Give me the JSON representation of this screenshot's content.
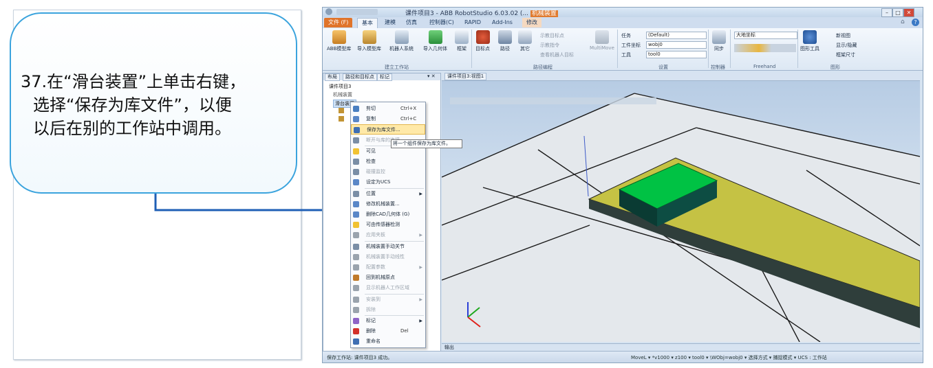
{
  "instruction": {
    "number": "37.",
    "line1": "在“滑台装置”上单击右键，",
    "line2": "选择“保存为库文件”，以便",
    "line3": "以后在别的工作站中调用。"
  },
  "window": {
    "title": "课件项目3 - ABB RobotStudio 6.03.02 (...",
    "title_highlight": "机械装置"
  },
  "tabs": [
    "文件 (F)",
    "基本",
    "建模",
    "仿真",
    "控制器(C)",
    "RAPID",
    "Add-Ins",
    "修改"
  ],
  "ribbon": {
    "buttons": [
      "ABB模型库",
      "导入模型库",
      "机器人系统",
      "导入几何体",
      "框架",
      "目标点",
      "路径",
      "其它"
    ],
    "path_items": [
      "示教目标点",
      "示教指令",
      "查看机器人目标"
    ],
    "multimove": "MultiMove",
    "settings_labels": [
      "任务",
      "工件坐标",
      "工具"
    ],
    "settings_values": [
      "(Default)",
      "wobj0",
      "tool0"
    ],
    "freehand_select": "大地坐标",
    "sync": "同步",
    "graphics_tools": "图形工具",
    "view_items": [
      "新视图",
      "显示/隐藏",
      "框架尺寸"
    ],
    "groups": [
      "建立工作站",
      "路径编程",
      "设置",
      "控制器",
      "Freehand",
      "图形"
    ]
  },
  "tree": {
    "tabs": [
      "布局",
      "路径和目标点",
      "标记"
    ],
    "root": "课件项目3",
    "mechanisms": "机械装置",
    "selected": "滑台装置"
  },
  "context_menu": [
    {
      "label": "剪切",
      "shortcut": "Ctrl+X"
    },
    {
      "label": "复制",
      "shortcut": "Ctrl+C"
    },
    {
      "label": "保存为库文件...",
      "highlight": true
    },
    {
      "label": "断开与库的连接",
      "disabled": true
    },
    {
      "label": "可见",
      "checked": true
    },
    {
      "label": "检查"
    },
    {
      "label": "碰撞监控",
      "disabled": true
    },
    {
      "label": "设定为UCS"
    },
    {
      "label": "位置",
      "submenu": true
    },
    {
      "label": "修改机械装置..."
    },
    {
      "label": "删除CAD几何体 (G)"
    },
    {
      "label": "可由传感器检测",
      "checked": true
    },
    {
      "label": "应用夹板",
      "disabled": true,
      "submenu": true
    },
    {
      "label": "机械装置手动关节"
    },
    {
      "label": "机械装置手动线性",
      "disabled": true
    },
    {
      "label": "配置参数",
      "disabled": true,
      "submenu": true
    },
    {
      "label": "回到机械原点"
    },
    {
      "label": "显示机器人工作区域",
      "disabled": true
    },
    {
      "label": "安装到",
      "disabled": true,
      "submenu": true
    },
    {
      "label": "拆除",
      "disabled": true
    },
    {
      "label": "标记",
      "submenu": true
    },
    {
      "label": "删除",
      "shortcut": "Del"
    },
    {
      "label": "重命名"
    }
  ],
  "tooltip": "将一个组件保存为库文件。",
  "viewport_tab": "课件项目3:视图1",
  "output_tab": "输出",
  "status": {
    "left": "保存工作站: 课件项目3 成功。",
    "right": "MoveL ▾ *v1000 ▾ z100 ▾ tool0 ▾ \\WObj=wobj0 ▾   选择方式 ▾ 捕捉模式 ▾  UCS : 工作站"
  },
  "colors": {
    "accent_file_tab": "#e0742a",
    "callout_border": "#3aa3dd",
    "arrow": "#1f5fb6",
    "slide_top": "#c5c244",
    "block_top": "#00c244",
    "menu_highlight": "#ffe9a8"
  }
}
